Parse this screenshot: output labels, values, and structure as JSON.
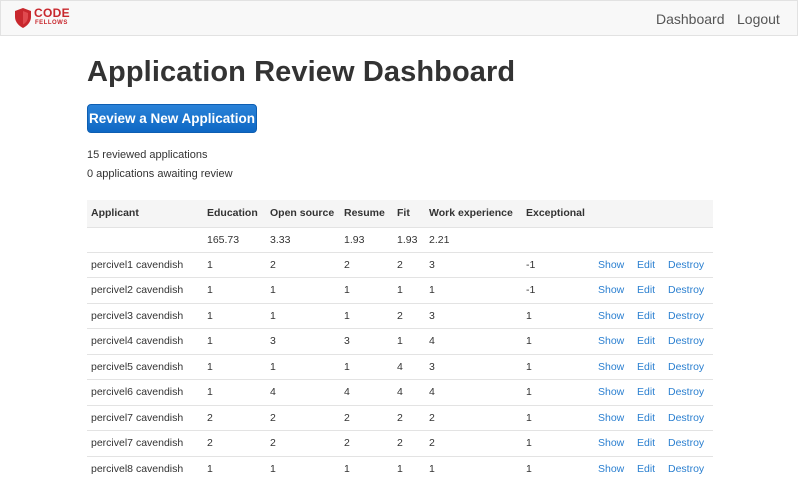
{
  "nav": {
    "logo_top": "CODE",
    "logo_bottom": "FELLOWS",
    "dashboard": "Dashboard",
    "logout": "Logout"
  },
  "page": {
    "title": "Application Review Dashboard",
    "review_button": "Review a New Application",
    "reviewed_count": "15 reviewed applications",
    "awaiting_count": "0 applications awaiting review"
  },
  "colors": {
    "brand_red": "#c8272d",
    "primary_blue": "#1a74cc",
    "link_blue": "#2a7fd0"
  },
  "table": {
    "headers": [
      "Applicant",
      "Education",
      "Open source",
      "Resume",
      "Fit",
      "Work experience",
      "Exceptional",
      "",
      "",
      ""
    ],
    "averages": [
      "",
      "165.73",
      "3.33",
      "1.93",
      "1.93",
      "2.21",
      "",
      "",
      "",
      ""
    ],
    "actions": {
      "show": "Show",
      "edit": "Edit",
      "destroy": "Destroy"
    },
    "rows": [
      [
        "percivel1 cavendish",
        "1",
        "2",
        "2",
        "2",
        "3",
        "-1"
      ],
      [
        "percivel2 cavendish",
        "1",
        "1",
        "1",
        "1",
        "1",
        "-1"
      ],
      [
        "percivel3 cavendish",
        "1",
        "1",
        "1",
        "2",
        "3",
        "1"
      ],
      [
        "percivel4 cavendish",
        "1",
        "3",
        "3",
        "1",
        "4",
        "1"
      ],
      [
        "percivel5 cavendish",
        "1",
        "1",
        "1",
        "4",
        "3",
        "1"
      ],
      [
        "percivel6 cavendish",
        "1",
        "4",
        "4",
        "4",
        "4",
        "1"
      ],
      [
        "percivel7 cavendish",
        "2",
        "2",
        "2",
        "2",
        "2",
        "1"
      ],
      [
        "percivel7 cavendish",
        "2",
        "2",
        "2",
        "2",
        "2",
        "1"
      ],
      [
        "percivel8 cavendish",
        "1",
        "1",
        "1",
        "1",
        "1",
        "1"
      ]
    ]
  }
}
